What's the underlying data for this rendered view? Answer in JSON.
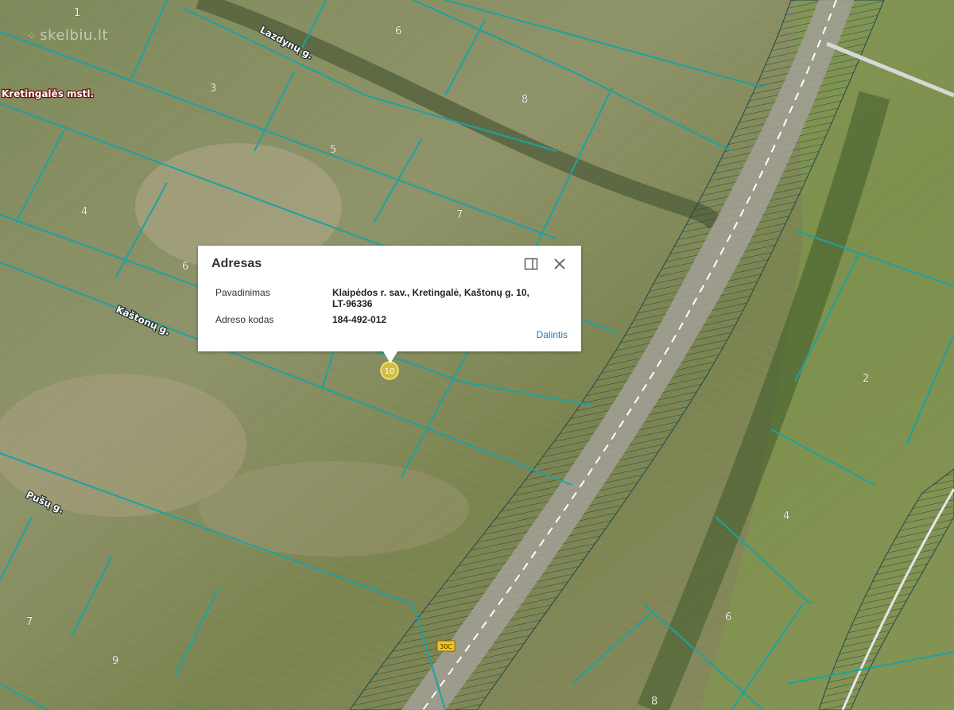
{
  "watermark": {
    "text": "skelbiu.lt",
    "dots_icon": "dot-grid-icon"
  },
  "map": {
    "town_label": "Kretingalės mstl.",
    "streets": [
      "Lazdynų g.",
      "Kaštonų g.",
      "Pušų g."
    ],
    "parcel_numbers": [
      "1",
      "6",
      "3",
      "8",
      "5",
      "4",
      "7",
      "6",
      "2",
      "4",
      "6",
      "7",
      "9",
      "8"
    ],
    "marker_label": "10",
    "road_shield": "30C"
  },
  "popup": {
    "title": "Adresas",
    "maximize_icon": "maximize-icon",
    "close_icon": "close-icon",
    "rows": [
      {
        "label": "Pavadinimas",
        "value_line1": "Klaipėdos r. sav., Kretingalė, Kaštonų g. 10,",
        "value_line2": "LT-96336"
      },
      {
        "label": "Adreso kodas",
        "value_line1": "184-492-012"
      }
    ],
    "share_label": "Dalintis"
  },
  "colors": {
    "parcel_line": "#1aa3a3",
    "link": "#1b7fc3",
    "marker": "#e8d23a"
  }
}
